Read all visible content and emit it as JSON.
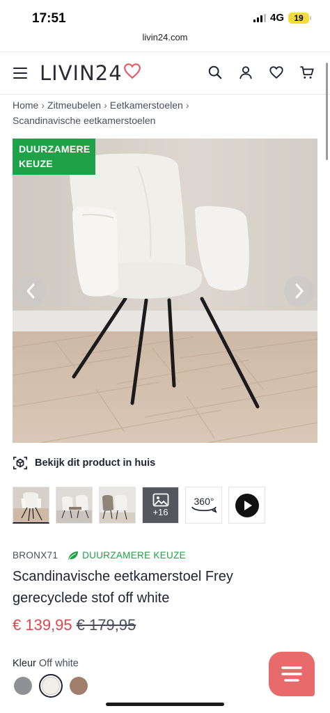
{
  "status_bar": {
    "time": "17:51",
    "network": "4G",
    "battery": "19"
  },
  "browser": {
    "url": "livin24.com"
  },
  "header": {
    "logo_text": "LIVIN24",
    "icons": [
      "menu-icon",
      "search-icon",
      "account-icon",
      "heart-icon",
      "cart-icon"
    ]
  },
  "breadcrumb": {
    "items": [
      "Home",
      "Zitmeubelen",
      "Eetkamerstoelen",
      "Scandinavische eetkamerstoelen"
    ]
  },
  "gallery": {
    "badge_line1": "DUURZAMERE",
    "badge_line2": "KEUZE",
    "view_in_home": "Bekijk dit product in huis",
    "more_count": "+16",
    "spin_label": "360°"
  },
  "product": {
    "sku": "BRONX71",
    "eco_label": "DUURZAMERE KEUZE",
    "title": "Scandinavische eetkamerstoel Frey gerecyclede stof off white",
    "price_now": "€ 139,95",
    "price_old": "€ 179,95",
    "color_label": "Kleur",
    "color_value": "Off white",
    "swatches": [
      {
        "name": "grey",
        "hex": "#8f9194"
      },
      {
        "name": "off white",
        "hex": "#f2efe8"
      },
      {
        "name": "taupe",
        "hex": "#a07e6b"
      }
    ]
  },
  "colors": {
    "accent_green": "#1fa14a",
    "price_red": "#e0474c",
    "logo_heart": "#e35b63",
    "chat_button": "#e96a6a"
  }
}
